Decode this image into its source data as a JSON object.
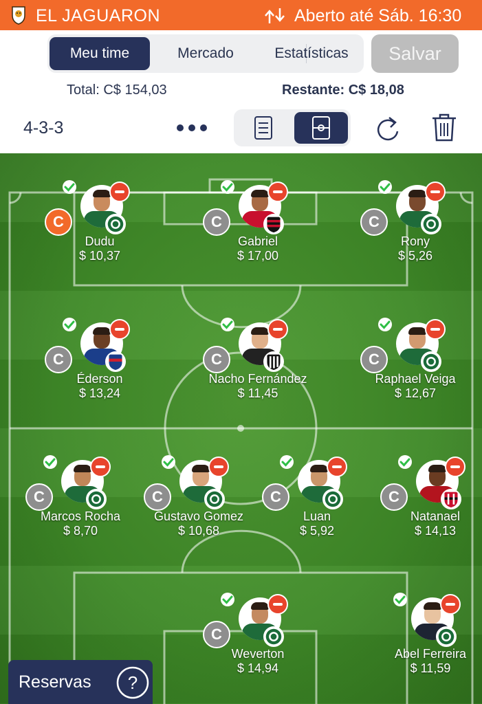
{
  "status_bar": {
    "team_name": "EL JAGUARON",
    "market_status": "Aberto até Sáb. 16:30",
    "accent": "#f26a2a"
  },
  "tabs": [
    {
      "label": "Meu time",
      "active": true
    },
    {
      "label": "Mercado",
      "active": false
    },
    {
      "label": "Estatísticas",
      "active": false
    }
  ],
  "save_label": "Salvar",
  "budget": {
    "total": "Total: C$ 154,03",
    "remaining": "Restante: C$ 18,08"
  },
  "toolbar": {
    "formation": "4-3-3",
    "icons": [
      "more-icon",
      "list-view-icon",
      "field-view-icon",
      "refresh-icon",
      "trash-icon"
    ]
  },
  "players": [
    {
      "name": "Dudu",
      "price": "$ 10,37",
      "club": "palmeiras",
      "captain": true
    },
    {
      "name": "Gabriel",
      "price": "$ 17,00",
      "club": "flamengo",
      "captain": false
    },
    {
      "name": "Rony",
      "price": "$ 5,26",
      "club": "palmeiras",
      "captain": false
    },
    {
      "name": "Éderson",
      "price": "$ 13,24",
      "club": "fortaleza",
      "captain": false
    },
    {
      "name": "Nacho Fernández",
      "price": "$ 11,45",
      "club": "atletico-mg",
      "captain": false
    },
    {
      "name": "Raphael Veiga",
      "price": "$ 12,67",
      "club": "palmeiras",
      "captain": false
    },
    {
      "name": "Marcos Rocha",
      "price": "$ 8,70",
      "club": "palmeiras",
      "captain": false
    },
    {
      "name": "Gustavo Gomez",
      "price": "$ 10,68",
      "club": "palmeiras",
      "captain": false
    },
    {
      "name": "Luan",
      "price": "$ 5,92",
      "club": "palmeiras",
      "captain": false
    },
    {
      "name": "Natanael",
      "price": "$ 14,13",
      "club": "atletico-go",
      "captain": false
    },
    {
      "name": "Weverton",
      "price": "$ 14,94",
      "club": "palmeiras",
      "captain": false
    },
    {
      "name": "Abel Ferreira",
      "price": "$ 11,59",
      "club": "palmeiras",
      "captain": null
    }
  ],
  "captain_label": "C",
  "reserves": {
    "label": "Reservas",
    "help": "?"
  }
}
